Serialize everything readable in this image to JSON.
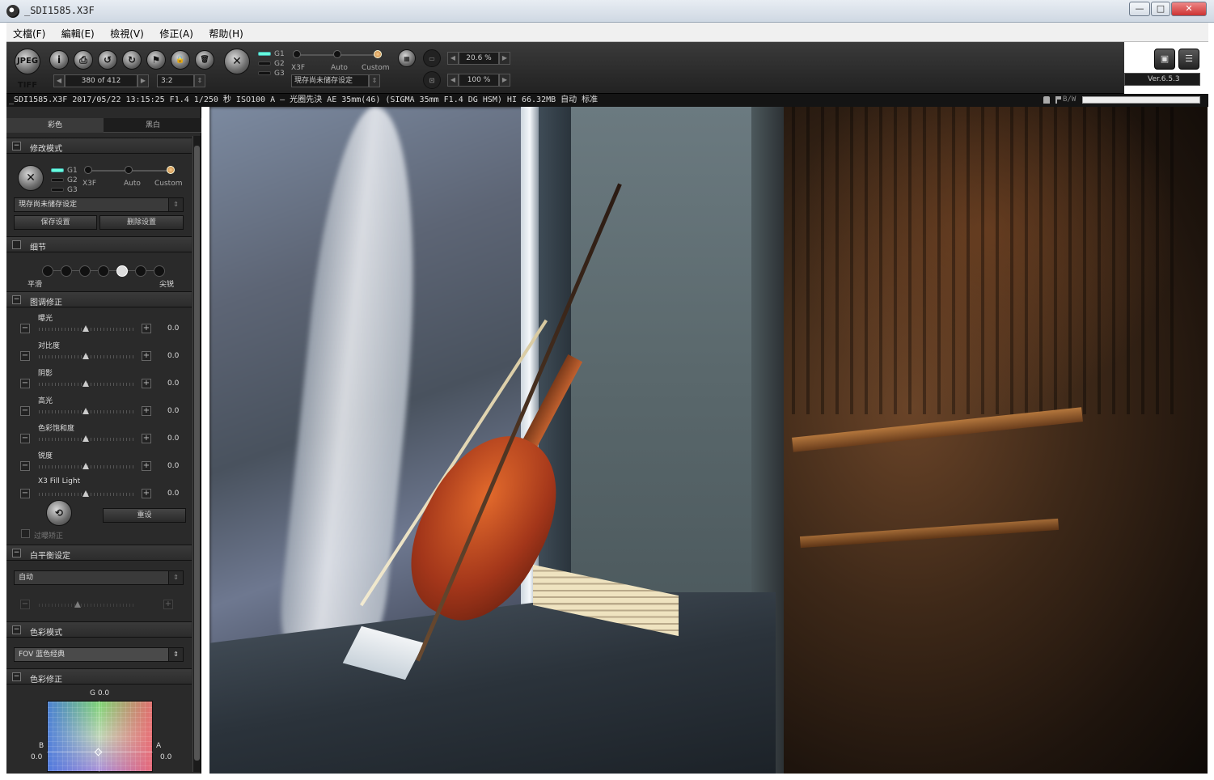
{
  "window": {
    "title": "_SDI1585.X3F",
    "min": "—",
    "max": "□",
    "close": "✕"
  },
  "menu": [
    "文檔(F)",
    "編輯(E)",
    "檢視(V)",
    "修正(A)",
    "帮助(H)"
  ],
  "toolbar": {
    "save_tiff": "JPEG TIFF",
    "info": "i",
    "print": "⎙",
    "rotate_left": "↺",
    "rotate_right": "↻",
    "flag": "⚑",
    "lock": "🔒",
    "delete": "🗑",
    "x3f_mode": "✕",
    "counter": "380 of 412",
    "ratio": "3:2",
    "g_labels": [
      "G1",
      "G2",
      "G3"
    ],
    "mode_labels": [
      "X3F",
      "Auto",
      "Custom"
    ],
    "preset": "現存尚未储存设定",
    "zoom1": "20.6 %",
    "zoom2": "100 %",
    "version": "Ver.6.5.3"
  },
  "info_bar": {
    "text": "_SDI1585.X3F 2017/05/22 13:15:25 F1.4 1/250 秒 ISO100 A — 光圈先決 AE 35mm(46) (SIGMA 35mm F1.4 DG HSM) HI 66.32MB 自动 标准",
    "bw": "B/W"
  },
  "panel": {
    "tabs": [
      "彩色",
      "黑白"
    ],
    "mode_section": {
      "title": "修改模式",
      "g_labels": [
        "G1",
        "G2",
        "G3"
      ],
      "mode_labels": [
        "X3F",
        "Auto",
        "Custom"
      ],
      "preset": "現存尚未储存设定",
      "save_btn": "保存设置",
      "delete_btn": "删除设置"
    },
    "detail_section": {
      "title": "细节",
      "left": "平滑",
      "right": "尖锐",
      "level": 4,
      "levels": 7
    },
    "tone_section": {
      "title": "图调修正",
      "adjustments": [
        {
          "label": "曝光",
          "value": "0.0"
        },
        {
          "label": "对比度",
          "value": "0.0"
        },
        {
          "label": "阴影",
          "value": "0.0"
        },
        {
          "label": "高光",
          "value": "0.0"
        },
        {
          "label": "色彩饱和度",
          "value": "0.0"
        },
        {
          "label": "锐度",
          "value": "0.0"
        },
        {
          "label": "X3 Fill Light",
          "value": "0.0"
        }
      ],
      "reset_btn": "重设",
      "overexposure": "过曝矫正"
    },
    "wb_section": {
      "title": "白平衡设定",
      "value": "自动"
    },
    "color_mode_section": {
      "title": "色彩模式",
      "value": "FOV 蓝色经典"
    },
    "color_correct_section": {
      "title": "色彩修正",
      "g": "G 0.0",
      "b": "B",
      "b_val": "0.0",
      "a": "A",
      "a_val": "0.0"
    }
  }
}
